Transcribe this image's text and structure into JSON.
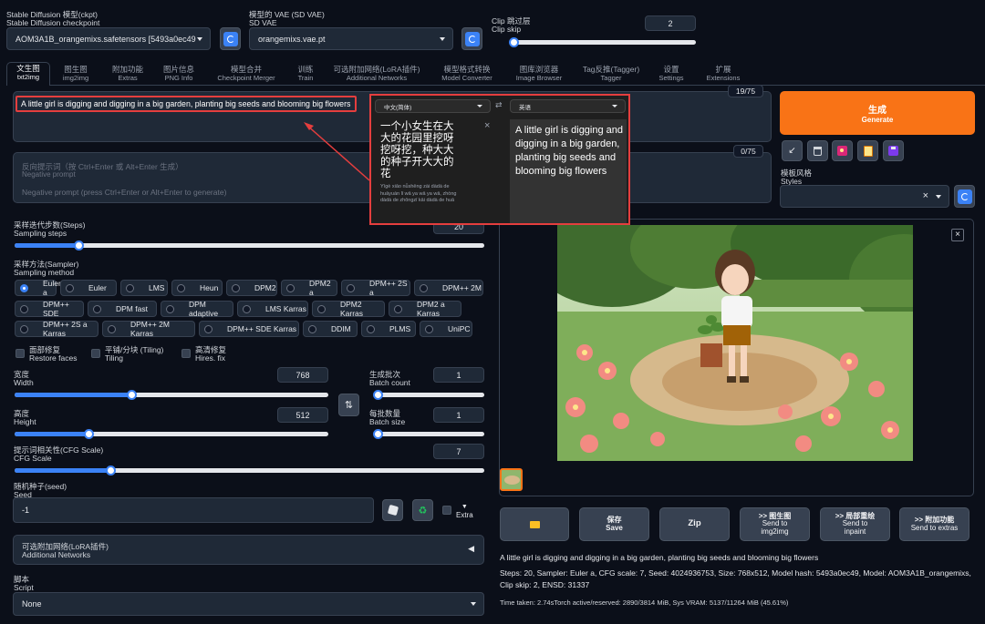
{
  "top": {
    "checkpoint": {
      "label_zh": "Stable Diffusion 模型(ckpt)",
      "label_en": "Stable Diffusion checkpoint",
      "value": "AOM3A1B_orangemixs.safetensors [5493a0ec49"
    },
    "vae": {
      "label_zh": "模型的 VAE (SD VAE)",
      "label_en": "SD VAE",
      "value": "orangemixs.vae.pt"
    },
    "clip": {
      "label_zh": "Clip 跳过层",
      "label_en": "Clip skip",
      "value": "2"
    }
  },
  "tabs": [
    {
      "zh": "文生图",
      "en": "txt2img"
    },
    {
      "zh": "图生图",
      "en": "img2img"
    },
    {
      "zh": "附加功能",
      "en": "Extras"
    },
    {
      "zh": "图片信息",
      "en": "PNG Info"
    },
    {
      "zh": "模型合并",
      "en": "Checkpoint Merger"
    },
    {
      "zh": "训练",
      "en": "Train"
    },
    {
      "zh": "可选附加网络(LoRA插件)",
      "en": "Additional Networks"
    },
    {
      "zh": "模型格式转换",
      "en": "Model Converter"
    },
    {
      "zh": "图库浏览器",
      "en": "Image Browser"
    },
    {
      "zh": "Tag反推(Tagger)",
      "en": "Tagger"
    },
    {
      "zh": "设置",
      "en": "Settings"
    },
    {
      "zh": "扩展",
      "en": "Extensions"
    }
  ],
  "prompt": {
    "value": "A little girl is digging and digging in a big garden, planting big seeds and blooming big flowers",
    "count": "19/75"
  },
  "negative": {
    "ph_zh": "反向提示词（按 Ctrl+Enter 或 Alt+Enter 生成）",
    "ph_en": "Negative prompt",
    "placeholder": "Negative prompt (press Ctrl+Enter or Alt+Enter to generate)",
    "count": "0/75"
  },
  "translator": {
    "source_lang": "中文(简体)",
    "target_lang": "英语",
    "source_text": "一个小女生在大大的花园里挖呀挖呀挖，种大大的种子开大大的花",
    "pinyin": "Yīgè xiǎo nǚshēng zài dàdà de huāyuán lǐ wā ya wā ya wā, zhòng dàdà de zhǒngzǐ kāi dàdà de huā",
    "target_text": "A little girl is digging and digging in a big garden, planting big seeds and blooming big flowers",
    "swap": "⇄",
    "close": "×"
  },
  "generate": {
    "zh": "生成",
    "en": "Generate"
  },
  "styles": {
    "zh": "模板风格",
    "en": "Styles",
    "clear": "×"
  },
  "steps": {
    "zh": "采样迭代步数(Steps)",
    "en": "Sampling steps",
    "value": "20",
    "fraction": 0.13
  },
  "sampler": {
    "zh": "采样方法(Sampler)",
    "en": "Sampling method",
    "options": [
      [
        "Euler a",
        "Euler",
        "LMS",
        "Heun",
        "DPM2",
        "DPM2 a",
        "DPM++ 2S a",
        "DPM++ 2M"
      ],
      [
        "DPM++ SDE",
        "DPM fast",
        "DPM adaptive",
        "LMS Karras",
        "DPM2 Karras",
        "DPM2 a Karras"
      ],
      [
        "DPM++ 2S a Karras",
        "DPM++ 2M Karras",
        "DPM++ SDE Karras",
        "DDIM",
        "PLMS",
        "UniPC"
      ]
    ],
    "selected": "Euler a"
  },
  "checks": [
    {
      "zh": "面部修复",
      "en": "Restore faces"
    },
    {
      "zh": "平铺/分块 (Tiling)",
      "en": "Tiling"
    },
    {
      "zh": "高清修复",
      "en": "Hires. fix"
    }
  ],
  "width": {
    "zh": "宽度",
    "en": "Width",
    "value": "768",
    "fraction": 0.37
  },
  "height": {
    "zh": "高度",
    "en": "Height",
    "value": "512",
    "fraction": 0.23
  },
  "batch_count": {
    "zh": "生成批次",
    "en": "Batch count",
    "value": "1",
    "fraction": 0.0
  },
  "batch_size": {
    "zh": "每批数量",
    "en": "Batch size",
    "value": "1",
    "fraction": 0.0
  },
  "swap_icon": "⇅",
  "cfg": {
    "zh": "提示词相关性(CFG Scale)",
    "en": "CFG Scale",
    "value": "7",
    "fraction": 0.2
  },
  "seed": {
    "zh": "随机种子(seed)",
    "en": "Seed",
    "value": "-1",
    "extra": "Extra",
    "extra_arrow": "▼"
  },
  "addnet": {
    "zh": "可选附加网络(LoRA插件)",
    "en": "Additional Networks",
    "arrow": "◀"
  },
  "script": {
    "zh": "脚本",
    "en": "Script",
    "value": "None"
  },
  "output": {
    "close": "×",
    "buttons": [
      {
        "zh": "",
        "en": ""
      },
      {
        "zh": "保存",
        "en": "Save"
      },
      {
        "zh": "Zip",
        "en": ""
      },
      {
        "zh": ">> 图生图",
        "en": "Send to img2img"
      },
      {
        "zh": ">> 局部重绘",
        "en": "Send to inpaint"
      },
      {
        "zh": ">> 附加功能",
        "en": "Send to extras"
      }
    ],
    "info_prompt": "A little girl is digging and digging in a big garden, planting big seeds and blooming big flowers",
    "info_params": "Steps: 20, Sampler: Euler a, CFG scale: 7, Seed: 4024936753, Size: 768x512, Model hash: 5493a0ec49, Model: AOM3A1B_orangemixs, Clip skip: 2, ENSD: 31337",
    "time": "Time taken: 2.74sTorch active/reserved: 2890/3814 MiB, Sys VRAM: 5137/11264 MiB (45.61%)"
  },
  "colors": {
    "accent": "#3b82f6",
    "generate": "#f97316",
    "annotation": "#e53e3e"
  }
}
